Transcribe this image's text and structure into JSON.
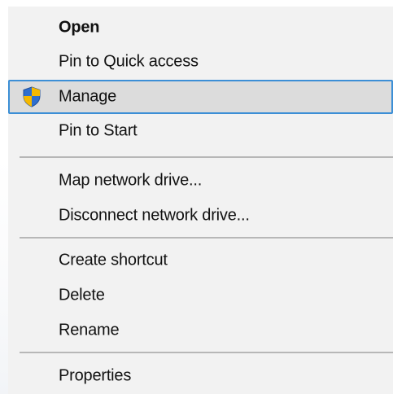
{
  "context_menu": {
    "items": [
      {
        "label": "Open",
        "bold": true
      },
      {
        "label": "Pin to Quick access"
      },
      {
        "label": "Manage",
        "icon": "uac-shield-icon",
        "highlighted": true
      },
      {
        "label": "Pin to Start"
      },
      {
        "label": "Map network drive..."
      },
      {
        "label": "Disconnect network drive..."
      },
      {
        "label": "Create shortcut"
      },
      {
        "label": "Delete"
      },
      {
        "label": "Rename"
      },
      {
        "label": "Properties"
      }
    ]
  },
  "colors": {
    "menu_background": "#f2f2f2",
    "highlight_background": "#dcdcdc",
    "highlight_border": "#3c8fd6",
    "separator": "#b7b7b7",
    "shield_blue": "#2f6fce",
    "shield_yellow": "#f5b800"
  }
}
